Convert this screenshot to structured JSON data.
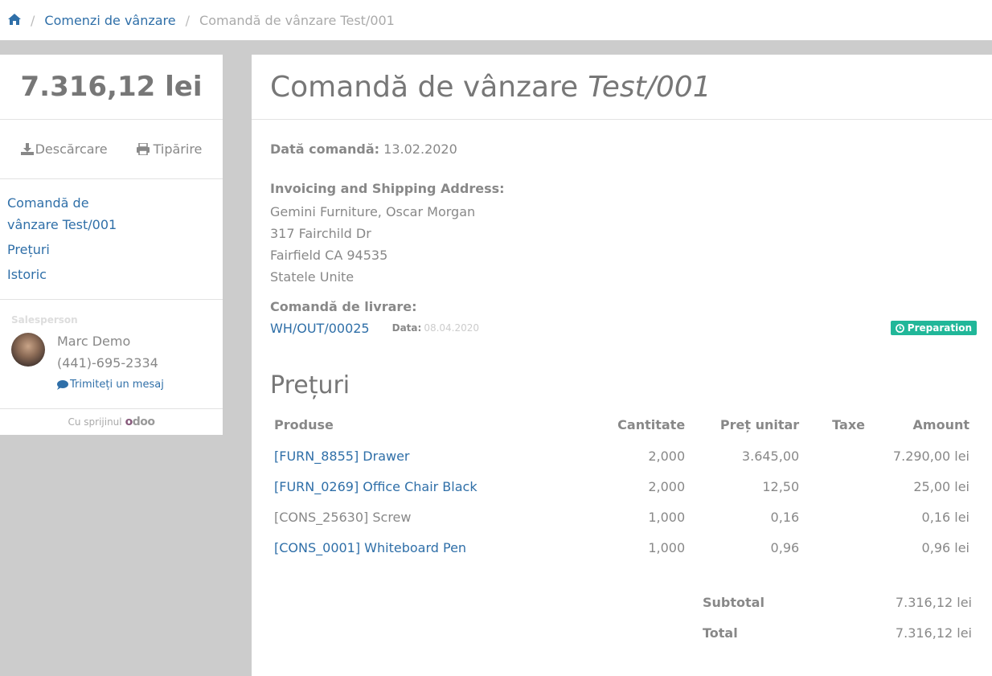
{
  "breadcrumb": {
    "home_icon": "home-icon",
    "items": [
      "Comenzi de vânzare",
      "Comandă de vânzare Test/001"
    ]
  },
  "sidebar": {
    "total": "7.316,12 lei",
    "actions": {
      "download_label": "Descărcare",
      "download_icon": "download-icon",
      "print_label": "Tipărire",
      "print_icon": "print-icon"
    },
    "nav": [
      "Comandă de vânzare Test/001",
      "Prețuri",
      "Istoric"
    ],
    "salesperson": {
      "label": "Salesperson",
      "name": "Marc Demo",
      "phone": "(441)-695-2334",
      "message_label": "Trimiteți un mesaj",
      "message_icon": "comment-icon"
    },
    "powered_by": "Cu sprijinul",
    "brand": "odoo"
  },
  "main": {
    "title_prefix": "Comandă de vânzare",
    "title_ref": "Test/001",
    "order_date_label": "Dată comandă:",
    "order_date": "13.02.2020",
    "address_label": "Invoicing and Shipping Address:",
    "address_lines": [
      "Gemini Furniture, Oscar Morgan",
      "317 Fairchild Dr",
      "Fairfield CA 94535",
      "Statele Unite"
    ],
    "delivery_label": "Comandă de livrare:",
    "delivery": {
      "ref": "WH/OUT/00025",
      "date_label": "Data:",
      "date": "08.04.2020",
      "status": "Preparation",
      "status_icon": "clock-icon",
      "status_color": "#21b799"
    },
    "pricing_title": "Prețuri",
    "table": {
      "headers": [
        "Produse",
        "Cantitate",
        "Preț unitar",
        "Taxe",
        "Amount"
      ],
      "rows": [
        {
          "product": "[FURN_8855] Drawer",
          "link": true,
          "qty": "2,000",
          "unit_price": "3.645,00",
          "taxes": "",
          "amount": "7.290,00 lei"
        },
        {
          "product": "[FURN_0269] Office Chair Black",
          "link": true,
          "qty": "2,000",
          "unit_price": "12,50",
          "taxes": "",
          "amount": "25,00 lei"
        },
        {
          "product": "[CONS_25630] Screw",
          "link": false,
          "qty": "1,000",
          "unit_price": "0,16",
          "taxes": "",
          "amount": "0,16 lei"
        },
        {
          "product": "[CONS_0001] Whiteboard Pen",
          "link": true,
          "qty": "1,000",
          "unit_price": "0,96",
          "taxes": "",
          "amount": "0,96 lei"
        }
      ]
    },
    "totals": {
      "subtotal_label": "Subtotal",
      "subtotal": "7.316,12 lei",
      "total_label": "Total",
      "total": "7.316,12 lei"
    }
  },
  "colors": {
    "link": "#2f6fa8",
    "badge": "#21b799",
    "background": "#cccccc",
    "brand": "#875a7b"
  }
}
